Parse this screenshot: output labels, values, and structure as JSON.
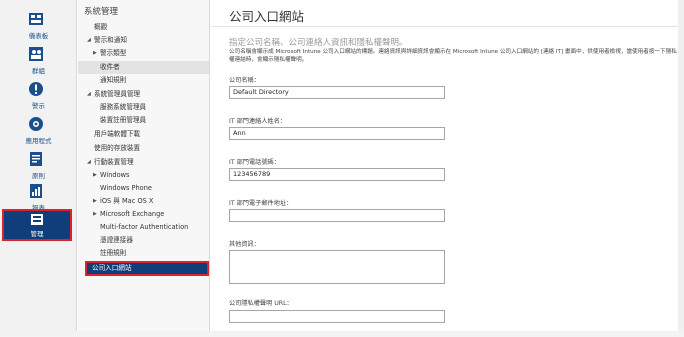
{
  "rail": [
    {
      "label": "儀表板",
      "icon": "dashboard-icon"
    },
    {
      "label": "群組",
      "icon": "groups-icon"
    },
    {
      "label": "警示",
      "icon": "alert-icon"
    },
    {
      "label": "應用程式",
      "icon": "apps-icon"
    },
    {
      "label": "原則",
      "icon": "policy-icon"
    },
    {
      "label": "報表",
      "icon": "reports-icon"
    },
    {
      "label": "管理",
      "icon": "admin-icon",
      "active": true
    }
  ],
  "nav": {
    "title": "系統管理",
    "items": [
      {
        "label": "概觀"
      },
      {
        "label": "警示和通知",
        "expandable": true
      },
      {
        "label": "警示類型",
        "expandable": true
      },
      {
        "label": "收件者",
        "selected": true
      },
      {
        "label": "通知規則"
      },
      {
        "label": "系統管理員管理",
        "expandable": true
      },
      {
        "label": "服務系統管理員"
      },
      {
        "label": "裝置註冊管理員"
      },
      {
        "label": "用戶端軟體下載"
      },
      {
        "label": "使用的存放裝置"
      },
      {
        "label": "行動裝置管理",
        "expandable": true
      },
      {
        "label": "Windows",
        "collapsed": true
      },
      {
        "label": "Windows Phone"
      },
      {
        "label": "iOS 與 Mac OS X",
        "collapsed": true
      },
      {
        "label": "Microsoft Exchange",
        "collapsed": true
      },
      {
        "label": "Multi-factor Authentication"
      },
      {
        "label": "憑證連接器"
      },
      {
        "label": "註冊規則"
      },
      {
        "label": "公司入口網站",
        "current": true
      }
    ]
  },
  "main": {
    "title": "公司入口網站",
    "section_heading": "指定公司名稱、公司連絡人資訊和隱私權聲明。",
    "description": "公司名稱會顯示成 Microsoft Intune 公司入口網站的標題。連絡資訊與詳細資訊會顯示在 Microsoft Intune 公司入口網站的 [連絡 IT] 畫面中，供使用者檢視，當使用者按一下隱私權連結時，會顯示隱私權聲明。",
    "fields": [
      {
        "label": "公司名稱：",
        "value": "Default Directory"
      },
      {
        "label": "IT 部門連絡人姓名：",
        "value": "Ann"
      },
      {
        "label": "IT 部門電話號碼：",
        "value": "123456789"
      },
      {
        "label": "IT 部門電子郵件地址：",
        "value": ""
      },
      {
        "label": "其他資訊：",
        "value": "",
        "multiline": true
      },
      {
        "label": "公司隱私權聲明 URL：",
        "value": ""
      }
    ]
  },
  "colors": {
    "accent": "#0f3e7a",
    "highlight_border": "#d9232f",
    "rail_bg": "#f2f2f2"
  }
}
